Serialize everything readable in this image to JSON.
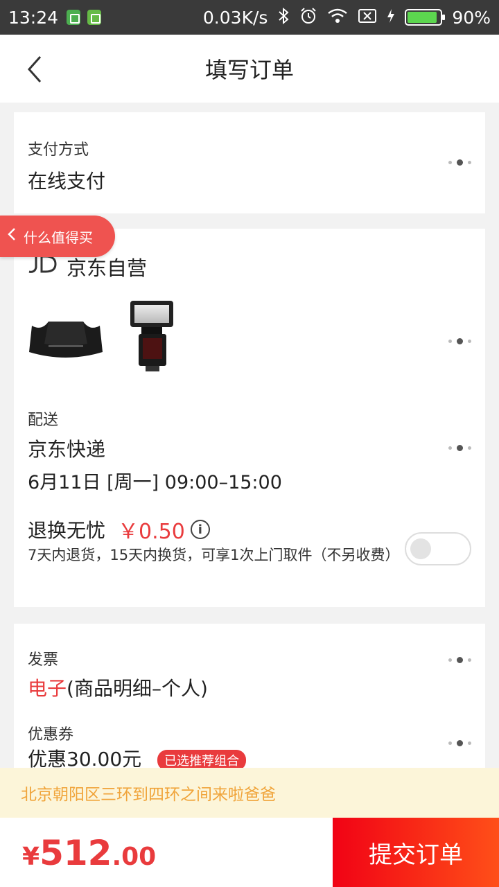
{
  "status_bar": {
    "time": "13:24",
    "network_speed": "0.03K/s",
    "battery_text": "90%",
    "battery_level": 0.9
  },
  "header": {
    "title": "填写订单"
  },
  "payment": {
    "label": "支付方式",
    "value": "在线支付"
  },
  "float_tag": {
    "label": "什么值得买"
  },
  "shop": {
    "name": "京东自营"
  },
  "delivery": {
    "label": "配送",
    "carrier": "京东快递",
    "time": "6月11日 [周一] 09:00–15:00"
  },
  "return_service": {
    "title": "退换无忧",
    "price": "￥0.50",
    "description": "7天内退货，15天内换货，可享1次上门取件（不另收费）",
    "enabled": false
  },
  "invoice": {
    "label": "发票",
    "type_highlight": "电子",
    "type_rest": "(商品明细–个人)"
  },
  "coupon": {
    "label": "优惠券",
    "value": "优惠30.00元",
    "badge": "已选推荐组合"
  },
  "notice": {
    "text": "北京朝阳区三环到四环之间来啦爸爸"
  },
  "footer": {
    "currency": "¥",
    "total_integer": "512",
    "total_decimal": ".00",
    "submit_label": "提交订单"
  },
  "colors": {
    "accent_red": "#e93b3d",
    "notice_bg": "#fcf5d9",
    "notice_text": "#f0a43a"
  }
}
